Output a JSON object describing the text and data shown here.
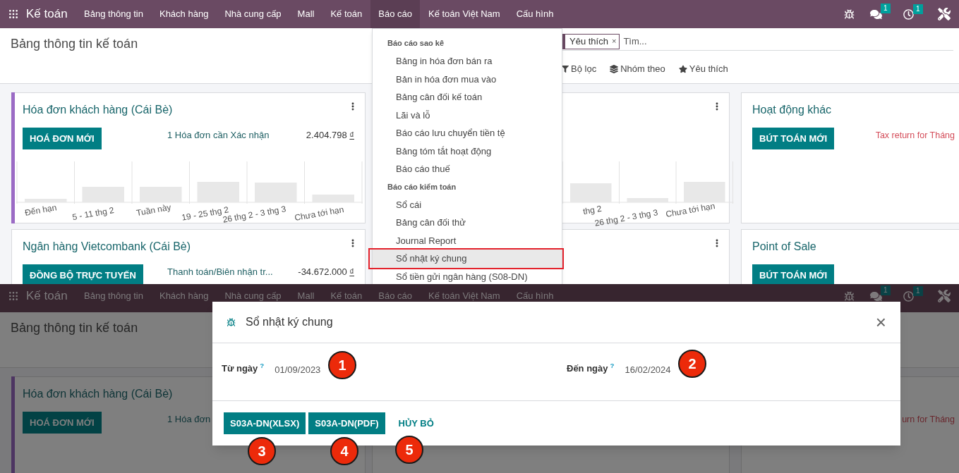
{
  "top": {
    "navbar": {
      "app": "Kế toán",
      "menu": [
        {
          "label": "Bảng thông tin",
          "selected": false
        },
        {
          "label": "Khách hàng",
          "selected": false
        },
        {
          "label": "Nhà cung cấp",
          "selected": false
        },
        {
          "label": "Mall",
          "selected": false
        },
        {
          "label": "Kế toán",
          "selected": false
        },
        {
          "label": "Báo cáo",
          "selected": true
        },
        {
          "label": "Kế toán Việt Nam",
          "selected": false
        },
        {
          "label": "Cấu hình",
          "selected": false
        }
      ],
      "messages_badge": "1",
      "activities_badge": "1"
    },
    "breadcrumb": "Bảng thông tin kế toán",
    "search": {
      "facet": "Yêu thích",
      "facet_remove": "×",
      "placeholder": "Tìm..."
    },
    "search_options": [
      {
        "kind": "filter",
        "label": "Bộ lọc"
      },
      {
        "kind": "group",
        "label": "Nhóm theo"
      },
      {
        "kind": "favorite",
        "label": "Yêu thích"
      }
    ],
    "cards": [
      {
        "kind": "journal",
        "title": "Hóa đơn khách hàng (Cái Bè)",
        "color": "#9b6bc5",
        "menu": true,
        "button": "HOÁ ĐƠN MỚI",
        "summary": "1 Hóa đơn cần Xác nhận",
        "amount": "2.404.798",
        "currency": "₫",
        "chart_labels": [
          "Đến hạn",
          "5 - 11 thg 2",
          "Tuần này",
          "19 - 25 thg 2",
          "26 thg 2 - 3 thg 3",
          "Chưa tới hạn"
        ]
      },
      {
        "kind": "journal",
        "menu": true,
        "chart_labels": [
          "thg 2",
          "26 thg 2 - 3 thg 3",
          "Chưa tới hạn"
        ]
      },
      {
        "kind": "journal",
        "title": "Hoạt động khác",
        "button": "BÚT TOÁN MỚI",
        "note": "Tax return for Tháng"
      },
      {
        "kind": "journal",
        "title": "Ngân hàng Vietcombank (Cái Bè)",
        "menu": true,
        "button": "ĐỒNG BỘ TRỰC TUYẾN",
        "summary": "Thanh toán/Biên nhận tr...",
        "amount": "-34.672.000",
        "currency": "₫"
      },
      {
        "kind": "journal",
        "menu": true
      },
      {
        "kind": "journal",
        "title": "Point of Sale",
        "button": "BÚT TOÁN MỚI"
      }
    ],
    "dropdown": [
      {
        "title": "Báo cáo sao kê",
        "items": [
          {
            "label": "Bảng in hóa đơn bán ra",
            "selected": false
          },
          {
            "label": "Bản in hóa đơn mua vào",
            "selected": false
          },
          {
            "label": "Bảng cân đối kế toán",
            "selected": false
          },
          {
            "label": "Lãi và lỗ",
            "selected": false
          },
          {
            "label": "Báo cáo lưu chuyển tiền tệ",
            "selected": false
          },
          {
            "label": "Bảng tóm tắt hoạt động",
            "selected": false
          },
          {
            "label": "Báo cáo thuế",
            "selected": false
          }
        ]
      },
      {
        "title": "Báo cáo kiểm toán",
        "items": [
          {
            "label": "Sổ cái",
            "selected": false
          },
          {
            "label": "Bảng cân đối thử",
            "selected": false
          },
          {
            "label": "Journal Report",
            "selected": false
          },
          {
            "label": "Sổ nhật ký chung",
            "selected": true
          },
          {
            "label": "Sổ tiền gửi ngân hàng (S08-DN)",
            "selected": false
          }
        ]
      }
    ]
  },
  "bottom": {
    "navbar": {
      "app": "Kế toán",
      "menu": [
        {
          "label": "Bảng thông tin",
          "selected": false
        },
        {
          "label": "Khách hàng",
          "selected": false
        },
        {
          "label": "Nhà cung cấp",
          "selected": false
        },
        {
          "label": "Mall",
          "selected": false
        },
        {
          "label": "Kế toán",
          "selected": false
        },
        {
          "label": "Báo cáo",
          "selected": false
        },
        {
          "label": "Kế toán Việt Nam",
          "selected": false
        },
        {
          "label": "Cấu hình",
          "selected": false
        }
      ],
      "messages_badge": "1",
      "activities_badge": "1"
    },
    "breadcrumb": "Bảng thông tin kế toán",
    "cards": [
      {
        "kind": "journal",
        "title": "Hóa đơn khách hàng (Cái Bè)",
        "color": "#4d3562",
        "button": "HOÁ ĐƠN MỚI",
        "summary": "1 Hóa đơn"
      },
      {
        "kind": "journal"
      },
      {
        "kind": "journal",
        "note": "urn for Tháng"
      }
    ],
    "dialog": {
      "title": "Sổ nhật ký chung",
      "close": "×",
      "fields": [
        {
          "label": "Từ ngày",
          "help": "?",
          "value": "01/09/2023"
        },
        {
          "label": "Đến ngày",
          "help": "?",
          "value": "16/02/2024"
        }
      ],
      "buttons": [
        {
          "kind": "primary",
          "label": "S03A-DN(XLSX)"
        },
        {
          "kind": "primary",
          "label": "S03A-DN(PDF)"
        },
        {
          "kind": "link",
          "label": "HỦY BỎ"
        }
      ]
    },
    "annotations": [
      "1",
      "2",
      "3",
      "4",
      "5"
    ]
  }
}
